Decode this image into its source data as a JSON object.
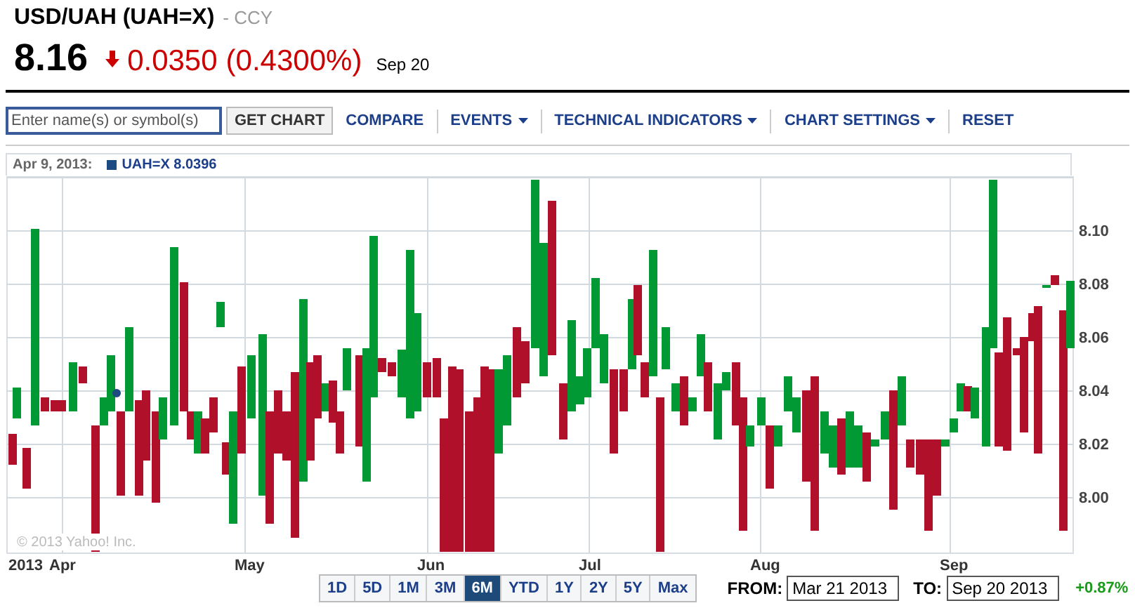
{
  "quote": {
    "title": "USD/UAH (UAH=X)",
    "exchange": "- CCY",
    "price": "8.16",
    "down": true,
    "change": "0.0350",
    "change_percent": "(0.4300%)",
    "date": "Sep 20"
  },
  "toolbar": {
    "search": {
      "placeholder": "Enter name(s) or symbol(s)"
    },
    "button": "GET CHART",
    "items": [
      {
        "label": "COMPARE",
        "kind": "link"
      },
      {
        "label": "EVENTS",
        "kind": "dropdown"
      },
      {
        "label": "TECHNICAL INDICATORS",
        "kind": "dropdown"
      },
      {
        "label": "CHART SETTINGS",
        "kind": "dropdown"
      },
      {
        "label": "RESET",
        "kind": "link"
      }
    ]
  },
  "chart": {
    "legend_date": "Apr 9, 2013:",
    "legend_series": "UAH=X 8.0396",
    "credit": "© 2013 Yahoo! Inc.",
    "y_labels": [
      "8.10",
      "8.08",
      "8.06",
      "8.04",
      "8.02",
      "8.00"
    ],
    "year": "2013",
    "months": [
      "Apr",
      "May",
      "Jun",
      "Jul",
      "Aug",
      "Sep"
    ]
  },
  "ranges": [
    {
      "label": "1D",
      "selected": false
    },
    {
      "label": "5D",
      "selected": false
    },
    {
      "label": "1M",
      "selected": false
    },
    {
      "label": "3M",
      "selected": false
    },
    {
      "label": "6M",
      "selected": true
    },
    {
      "label": "YTD",
      "selected": false
    },
    {
      "label": "1Y",
      "selected": false
    },
    {
      "label": "2Y",
      "selected": false
    },
    {
      "label": "5Y",
      "selected": false
    },
    {
      "label": "Max",
      "selected": false
    }
  ],
  "from": {
    "label": "FROM:",
    "value": "Mar 21 2013"
  },
  "to": {
    "label": "TO:",
    "value": "Sep 20 2013"
  },
  "period_change": "+0.87%"
}
